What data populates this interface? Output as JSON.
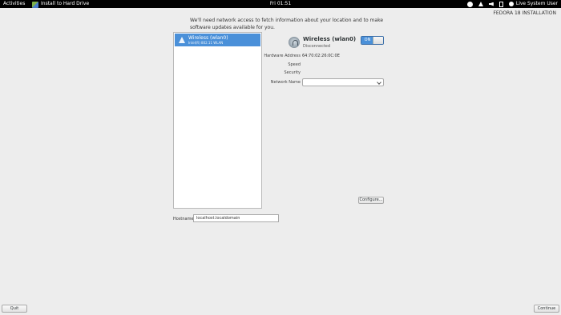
{
  "topbar": {
    "activities": "Activities",
    "app_name": "Install to Hard Drive",
    "clock": "Fri 01:51",
    "user": "Live System User",
    "tray_icons": [
      "accessibility-icon",
      "network-icon",
      "volume-icon",
      "battery-icon",
      "user-icon"
    ]
  },
  "header": {
    "product": "FEDORA 18 INSTALLATION",
    "intro": "We'll need network access to fetch information about your location and to make software updates available for you."
  },
  "network_list": {
    "items": [
      {
        "name": "Wireless (wlan0)",
        "subtitle": "Intel(R) 802.11 WLAN",
        "selected": true
      }
    ]
  },
  "device": {
    "title": "Wireless (wlan0)",
    "status": "Disconnected",
    "toggle_label": "ON",
    "fields": {
      "hardware_address_label": "Hardware Address",
      "hardware_address_value": "64:70:02:26:0C:0E",
      "speed_label": "Speed",
      "security_label": "Security",
      "network_name_label": "Network Name",
      "network_name_value": ""
    },
    "configure_label": "Configure..."
  },
  "hostname": {
    "label": "Hostname:",
    "value": "localhost.localdomain"
  },
  "footer": {
    "quit_label": "Quit",
    "continue_label": "Continue"
  },
  "colors": {
    "accent": "#4a90d9",
    "topbar": "#000000",
    "background": "#ededed"
  }
}
